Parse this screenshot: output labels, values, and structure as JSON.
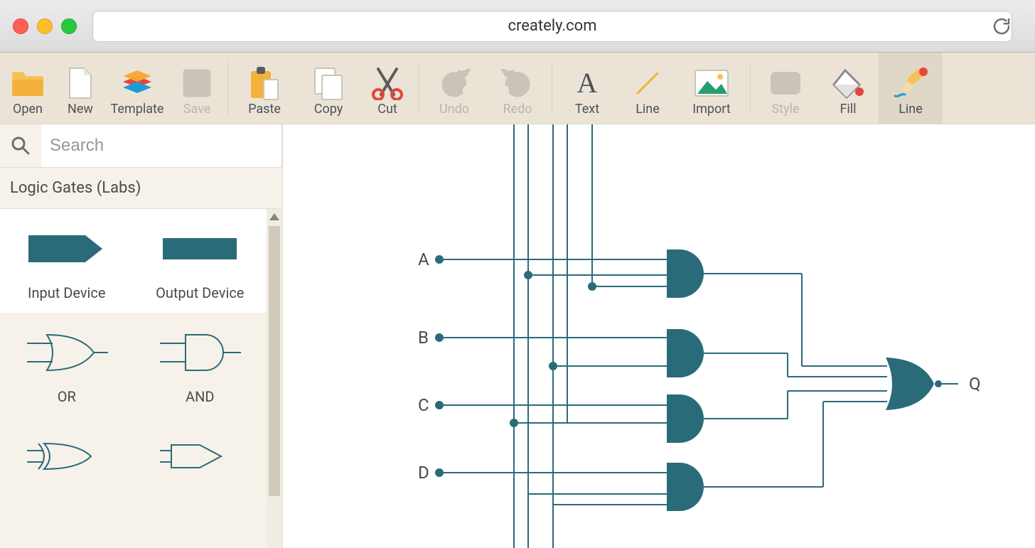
{
  "browser": {
    "url": "creately.com"
  },
  "toolbar": {
    "open": "Open",
    "new": "New",
    "template": "Template",
    "save": "Save",
    "paste": "Paste",
    "copy": "Copy",
    "cut": "Cut",
    "undo": "Undo",
    "redo": "Redo",
    "text": "Text",
    "line": "Line",
    "import": "Import",
    "style": "Style",
    "fill": "Fill",
    "line_style": "Line"
  },
  "sidebar": {
    "search_placeholder": "Search",
    "category": "Logic Gates (Labs)",
    "shapes": {
      "input_device": "Input Device",
      "output_device": "Output Device",
      "or": "OR",
      "and": "AND"
    }
  },
  "canvas": {
    "inputs": [
      "A",
      "B",
      "C",
      "D"
    ],
    "output": "Q"
  },
  "colors": {
    "teal": "#2a6b79",
    "accent_orange": "#f7a634",
    "accent_blue": "#1e9bd7",
    "accent_red": "#e4463d",
    "accent_green": "#3ab54a"
  }
}
